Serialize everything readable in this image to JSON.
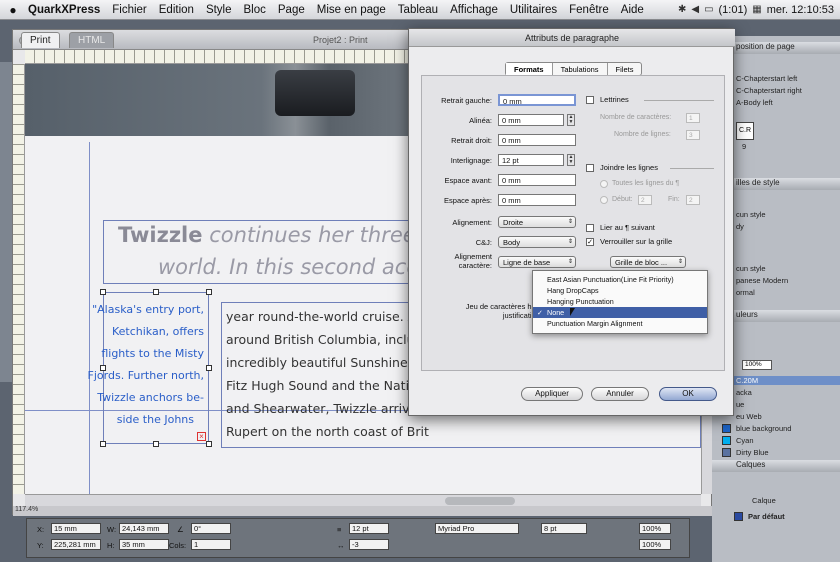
{
  "menubar": {
    "app": "QuarkXPress",
    "items": [
      "Fichier",
      "Edition",
      "Style",
      "Bloc",
      "Page",
      "Mise en page",
      "Tableau",
      "Affichage",
      "Utilitaires",
      "Fenêtre",
      "Aide"
    ],
    "battery": "(1:01)",
    "clock": "mer. 12:10:53"
  },
  "document": {
    "tab_print": "Print",
    "tab_html": "HTML",
    "title": "Projet2 : Print",
    "zoom": "117.4%",
    "headline_bold": "Twizzle",
    "headline_rest": " continues her three-yea",
    "headline_line2": "world. In this second accoun",
    "sidebar_lines": [
      "\"Alaska's entry port,",
      "Ketchikan, offers",
      "flights to the Misty",
      "Fjords. Further north,",
      "Twizzle anchors be-",
      "side the Johns"
    ],
    "body_lines": [
      "year round-the-world cruise. After",
      "around British Columbia, includir",
      "incredibly beautiful Sunshine Coas",
      "Fitz Hugh Sound and the Native Am",
      "and Shearwater, Twizzle arrived a",
      "Rupert on the north coast of Brit"
    ]
  },
  "dialog": {
    "title": "Attributs de paragraphe",
    "tabs": [
      "Formats",
      "Tabulations",
      "Filets"
    ],
    "fields": {
      "retrait_gauche": {
        "label": "Retrait gauche:",
        "value": "0 mm"
      },
      "alinea": {
        "label": "Alinéa:",
        "value": "0 mm"
      },
      "retrait_droit": {
        "label": "Retrait droit:",
        "value": "0 mm"
      },
      "interlignage": {
        "label": "Interlignage:",
        "value": "12 pt"
      },
      "espace_avant": {
        "label": "Espace avant:",
        "value": "0 mm"
      },
      "espace_apres": {
        "label": "Espace après:",
        "value": "0 mm"
      },
      "alignement": {
        "label": "Alignement:",
        "value": "Droite"
      },
      "cj": {
        "label": "C&J:",
        "value": "Body"
      },
      "alignement_caractere": {
        "label": "Alignement caractère:",
        "value": "Ligne de base"
      },
      "jeu_caracteres": {
        "label": "Jeu de caractères hors justification:"
      }
    },
    "lettrines": {
      "label": "Lettrines",
      "nb_car_label": "Nombre de caractères:",
      "nb_car_value": "1",
      "nb_lignes_label": "Nombre de lignes:",
      "nb_lignes_value": "3"
    },
    "joindre": {
      "label": "Joindre les lignes",
      "toutes": "Toutes les lignes du ¶",
      "debut_label": "Début:",
      "debut_value": "2",
      "fin_label": "Fin:",
      "fin_value": "2"
    },
    "lier": "Lier au ¶ suivant",
    "verrouiller": "Verrouiller sur la grille",
    "grille": "Grille de bloc ...",
    "popup_items": [
      "East Asian Punctuation(Line Fit Priority)",
      "Hang DropCaps",
      "Hanging Punctuation",
      "None",
      "Punctuation Margin Alignment"
    ],
    "popup_selected": "None",
    "buttons": {
      "apply": "Appliquer",
      "cancel": "Annuler",
      "ok": "OK"
    }
  },
  "palettes": {
    "page_layout": {
      "title": "position de page",
      "items": [
        "C-Chapterstart left",
        "C-Chapterstart right",
        "A-Body left"
      ],
      "page_label": "C.R",
      "page_number": "9"
    },
    "styles": {
      "title": "illes de style",
      "items": [
        "cun style",
        "dy"
      ]
    },
    "styles2": {
      "items": [
        "cun style",
        "panese Modern",
        "ormal"
      ]
    },
    "colors": {
      "title": "uleurs",
      "percent": "100%",
      "items": [
        "C.20M",
        "acka",
        "ue",
        "eu Web",
        "blue background",
        "Cyan",
        "Dirty Blue"
      ]
    },
    "layers": {
      "title": "Calques",
      "header": "Calque",
      "default": "Par défaut"
    }
  },
  "measurements": {
    "x": "15 mm",
    "y": "225,281 mm",
    "w": "24,143 mm",
    "h": "35 mm",
    "angle": "0°",
    "cols": "1",
    "leading": "12 pt",
    "tracking": "-3",
    "font": "Myriad Pro",
    "size": "8 pt",
    "scale1": "100%",
    "scale2": "100%"
  },
  "colors": {
    "accent": "#3f5fa6",
    "guide": "#7f8fc7",
    "sidebar_text": "#2a5ec8"
  }
}
